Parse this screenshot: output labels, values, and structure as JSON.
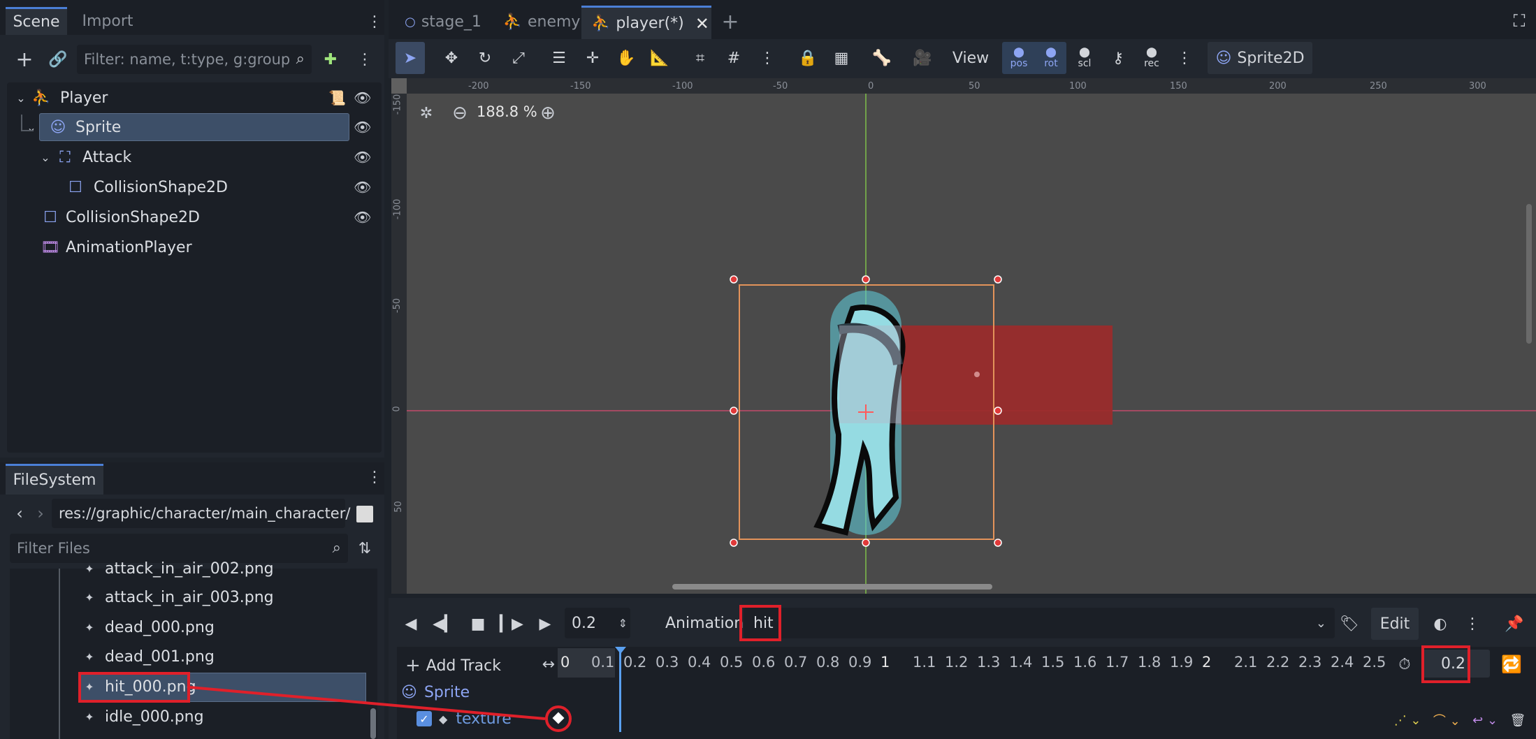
{
  "scene_dock": {
    "tabs": [
      "Scene",
      "Import"
    ],
    "filter_placeholder": "Filter: name, t:type, g:group",
    "nodes": [
      {
        "label": "Player"
      },
      {
        "label": "Sprite"
      },
      {
        "label": "Attack"
      },
      {
        "label": "CollisionShape2D"
      },
      {
        "label": "CollisionShape2D"
      },
      {
        "label": "AnimationPlayer"
      }
    ]
  },
  "filesystem": {
    "tab": "FileSystem",
    "path": "res://graphic/character/main_character/",
    "filter_placeholder": "Filter Files",
    "files": [
      {
        "label": "attack_in_air_002.png"
      },
      {
        "label": "attack_in_air_003.png"
      },
      {
        "label": "dead_000.png"
      },
      {
        "label": "dead_001.png"
      },
      {
        "label": "hit_000.png"
      },
      {
        "label": "idle_000.png"
      }
    ]
  },
  "editor_tabs": [
    {
      "label": "stage_1",
      "icon": "circle-icon"
    },
    {
      "label": "enemy",
      "icon": "node-icon"
    },
    {
      "label": "player(*)",
      "icon": "node-icon"
    }
  ],
  "toolbar": {
    "view_label": "View",
    "pos_label": "pos",
    "rot_label": "rot",
    "scl_label": "scl",
    "rec_label": "rec",
    "node_type": "Sprite2D"
  },
  "viewport": {
    "zoom": "188.8 %",
    "ruler_top": [
      "-200",
      "-150",
      "-100",
      "-50",
      "0",
      "50",
      "100",
      "150",
      "200",
      "250",
      "300"
    ],
    "ruler_left": [
      "-150",
      "-100",
      "-50",
      "0",
      "50"
    ]
  },
  "animation": {
    "time": "0.2",
    "label": "Animation",
    "name": "hit",
    "edit_label": "Edit",
    "add_track": "Add Track",
    "length": "0.2",
    "timeline": [
      "0",
      "0.1",
      "0.2",
      "0.3",
      "0.4",
      "0.5",
      "0.6",
      "0.7",
      "0.8",
      "0.9",
      "1",
      "1.1",
      "1.2",
      "1.3",
      "1.4",
      "1.5",
      "1.6",
      "1.7",
      "1.8",
      "1.9",
      "2",
      "2.1",
      "2.2",
      "2.3",
      "2.4",
      "2.5"
    ],
    "track_group": "Sprite",
    "track_prop": "texture"
  },
  "colors": {
    "accent": "#4b7fd6",
    "highlight": "#e0202a",
    "selection_box": "#e3935a",
    "hitbox": "#9b2a2a",
    "collision": "#5fc6d3"
  }
}
